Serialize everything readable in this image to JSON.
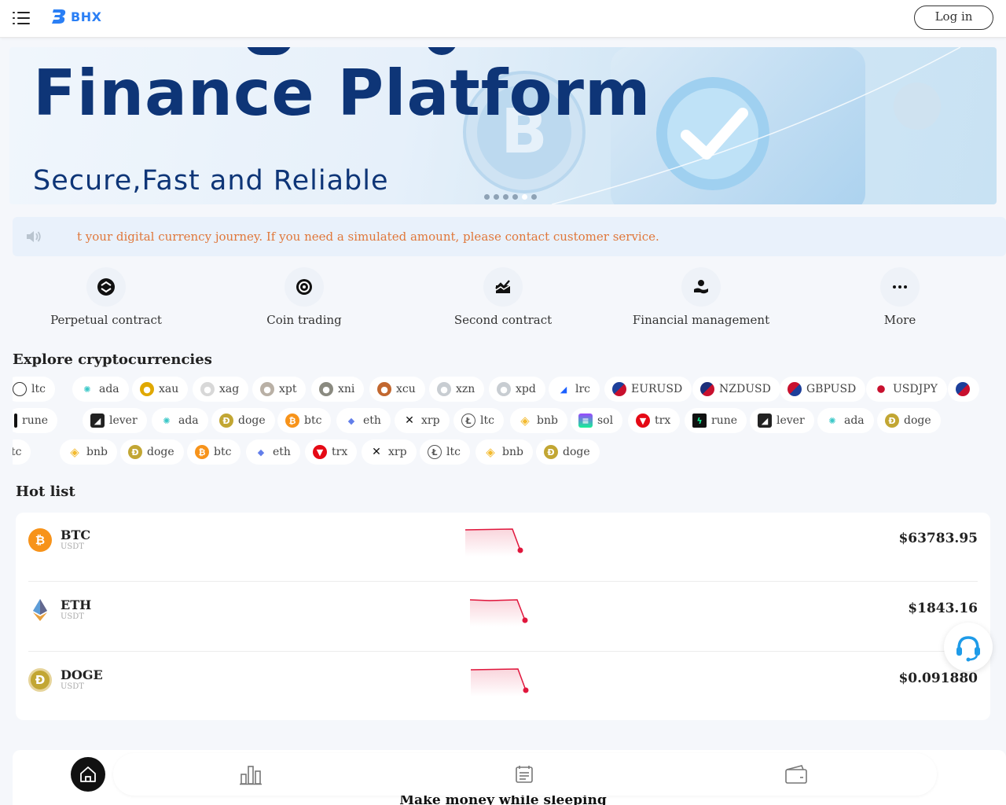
{
  "header": {
    "menu_icon": "hamburger-icon",
    "logo_text": "BHX",
    "login_label": "Log in"
  },
  "banner": {
    "title": "Finance Platform",
    "subtitle": "Secure,Fast and Reliable",
    "slide_count": 5,
    "active_slide": 4
  },
  "notice": {
    "icon": "speaker-icon",
    "text": "t your digital currency journey. If you need a simulated amount, please contact customer service."
  },
  "quick_menu": [
    {
      "label": "Perpetual contract",
      "icon": "perpetual-contract-icon"
    },
    {
      "label": "Coin trading",
      "icon": "coin-trading-icon"
    },
    {
      "label": "Second contract",
      "icon": "second-contract-icon"
    },
    {
      "label": "Financial management",
      "icon": "financial-management-icon"
    },
    {
      "label": "More",
      "icon": "more-dots-icon"
    }
  ],
  "explore": {
    "title": "Explore cryptocurrencies",
    "row1": [
      "ltc",
      "ada",
      "xau",
      "xag",
      "xpt",
      "xni",
      "xcu",
      "xzn",
      "xpd",
      "lrc",
      "EURUSD",
      "NZDUSD",
      "GBPUSD",
      "USDJPY"
    ],
    "row2": [
      "rune",
      "lever",
      "ada",
      "doge",
      "btc",
      "eth",
      "xrp",
      "ltc",
      "bnb",
      "sol",
      "trx",
      "rune",
      "lever",
      "ada",
      "doge"
    ],
    "row3": [
      "tc",
      "bnb",
      "doge",
      "btc",
      "eth",
      "trx",
      "xrp",
      "ltc",
      "bnb",
      "doge"
    ]
  },
  "hot_list": {
    "title": "Hot list",
    "items": [
      {
        "name": "BTC",
        "quote": "USDT",
        "price": "$63783.95",
        "icon": "btc-icon",
        "color": "#f7931a"
      },
      {
        "name": "ETH",
        "quote": "USDT",
        "price": "$1843.16",
        "icon": "eth-icon",
        "color": "#627eea"
      },
      {
        "name": "DOGE",
        "quote": "USDT",
        "price": "$0.091880",
        "icon": "doge-icon",
        "color": "#c2a633"
      }
    ],
    "trend_color": "#e0163c"
  },
  "support": {
    "icon": "customer-service-icon"
  },
  "bottom": {
    "title": "Make money while sleeping",
    "tabs": [
      {
        "icon": "home-icon"
      },
      {
        "icon": "market-chart-icon"
      },
      {
        "icon": "orders-icon"
      },
      {
        "icon": "wallet-icon"
      }
    ]
  },
  "colors": {
    "accent": "#2a7ff5",
    "notice_text": "#e0773a",
    "banner_title": "#0e3577"
  }
}
